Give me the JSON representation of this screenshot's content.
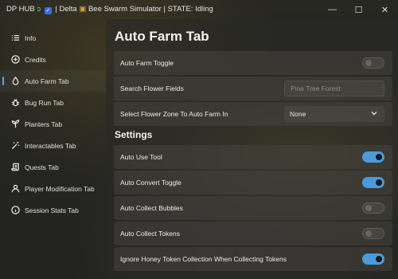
{
  "titlebar": {
    "hub": "DP HUB",
    "sep1": "| Delta",
    "game": "Bee Swarm Simulator",
    "state": "| STATE: Idling",
    "minimize": "—",
    "maximize": "☐",
    "close": "✕"
  },
  "sidebar": {
    "items": [
      {
        "label": "Info",
        "icon": "list-icon"
      },
      {
        "label": "Credits",
        "icon": "plus-circle-icon"
      },
      {
        "label": "Auto Farm Tab",
        "icon": "droplet-icon",
        "active": true
      },
      {
        "label": "Bug Run Tab",
        "icon": "bug-icon"
      },
      {
        "label": "Planters Tab",
        "icon": "sprout-icon"
      },
      {
        "label": "Interactables Tab",
        "icon": "wand-icon"
      },
      {
        "label": "Quests Tab",
        "icon": "scroll-icon"
      },
      {
        "label": "Player Modification Tab",
        "icon": "user-icon"
      },
      {
        "label": "Session Stats Tab",
        "icon": "info-icon"
      }
    ]
  },
  "main": {
    "title": "Auto Farm Tab",
    "auto_farm_toggle": {
      "label": "Auto Farm Toggle",
      "on": false
    },
    "search_fields": {
      "label": "Search Flower Fields",
      "placeholder": "Pine Tree Forest"
    },
    "select_zone": {
      "label": "Select Flower Zone To Auto Farm In",
      "value": "None"
    },
    "settings_header": "Settings",
    "settings": [
      {
        "label": "Auto Use Tool",
        "on": true
      },
      {
        "label": "Auto Convert Toggle",
        "on": true
      },
      {
        "label": "Auto Collect Bubbles",
        "on": false
      },
      {
        "label": "Auto Collect Tokens",
        "on": false
      },
      {
        "label": "Ignore Honey Token Collection When Collecting Tokens",
        "on": true
      }
    ]
  },
  "colors": {
    "accent": "#4a9bd9",
    "active_indicator": "#5aa7e6"
  }
}
